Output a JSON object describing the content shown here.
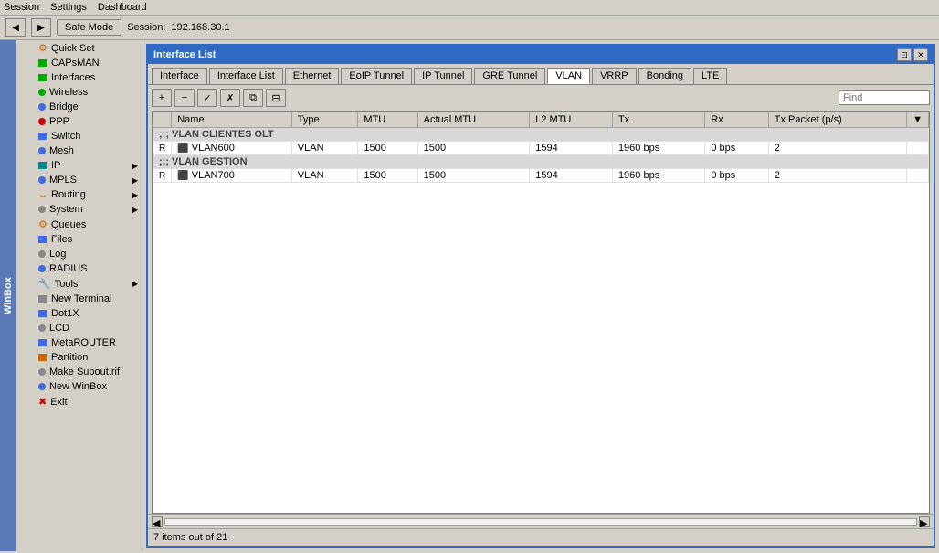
{
  "menubar": {
    "items": [
      "Session",
      "Settings",
      "Dashboard"
    ]
  },
  "toolbar": {
    "back_label": "◀",
    "forward_label": "▶",
    "safe_mode_label": "Safe Mode",
    "session_prefix": "Session:",
    "session_ip": "192.168.30.1"
  },
  "sidebar": {
    "items": [
      {
        "label": "Quick Set",
        "icon": "wrench",
        "color": "orange"
      },
      {
        "label": "CAPsMAN",
        "icon": "antenna",
        "color": "green"
      },
      {
        "label": "Interfaces",
        "icon": "interfaces",
        "color": "green"
      },
      {
        "label": "Wireless",
        "icon": "wireless",
        "color": "green"
      },
      {
        "label": "Bridge",
        "icon": "bridge",
        "color": "blue"
      },
      {
        "label": "PPP",
        "icon": "ppp",
        "color": "red"
      },
      {
        "label": "Switch",
        "icon": "switch",
        "color": "blue"
      },
      {
        "label": "Mesh",
        "icon": "mesh",
        "color": "blue"
      },
      {
        "label": "IP",
        "icon": "ip",
        "color": "blue",
        "has_sub": true
      },
      {
        "label": "MPLS",
        "icon": "mpls",
        "color": "blue",
        "has_sub": true
      },
      {
        "label": "Routing",
        "icon": "routing",
        "color": "orange",
        "has_sub": true
      },
      {
        "label": "System",
        "icon": "system",
        "color": "gray",
        "has_sub": true
      },
      {
        "label": "Queues",
        "icon": "queues",
        "color": "orange"
      },
      {
        "label": "Files",
        "icon": "files",
        "color": "blue"
      },
      {
        "label": "Log",
        "icon": "log",
        "color": "gray"
      },
      {
        "label": "RADIUS",
        "icon": "radius",
        "color": "blue"
      },
      {
        "label": "Tools",
        "icon": "tools",
        "color": "red",
        "has_sub": true
      },
      {
        "label": "New Terminal",
        "icon": "terminal",
        "color": "gray"
      },
      {
        "label": "Dot1X",
        "icon": "dot1x",
        "color": "blue"
      },
      {
        "label": "LCD",
        "icon": "lcd",
        "color": "gray"
      },
      {
        "label": "MetaROUTER",
        "icon": "metarouter",
        "color": "blue"
      },
      {
        "label": "Partition",
        "icon": "partition",
        "color": "orange"
      },
      {
        "label": "Make Supout.rif",
        "icon": "supout",
        "color": "gray"
      },
      {
        "label": "New WinBox",
        "icon": "winbox",
        "color": "blue"
      },
      {
        "label": "Exit",
        "icon": "exit",
        "color": "red"
      }
    ],
    "winbox_label": "WinBox"
  },
  "window": {
    "title": "Interface List",
    "tabs": [
      {
        "label": "Interface",
        "active": false
      },
      {
        "label": "Interface List",
        "active": false
      },
      {
        "label": "Ethernet",
        "active": false
      },
      {
        "label": "EoIP Tunnel",
        "active": false
      },
      {
        "label": "IP Tunnel",
        "active": false
      },
      {
        "label": "GRE Tunnel",
        "active": false
      },
      {
        "label": "VLAN",
        "active": true
      },
      {
        "label": "VRRP",
        "active": false
      },
      {
        "label": "Bonding",
        "active": false
      },
      {
        "label": "LTE",
        "active": false
      }
    ],
    "toolbar_buttons": [
      {
        "label": "+",
        "title": "Add"
      },
      {
        "label": "−",
        "title": "Remove"
      },
      {
        "label": "✓",
        "title": "Enable"
      },
      {
        "label": "✗",
        "title": "Disable"
      },
      {
        "label": "⧉",
        "title": "Copy"
      },
      {
        "label": "⊟",
        "title": "Filter"
      }
    ],
    "search_placeholder": "Find",
    "table": {
      "columns": [
        "",
        "Name",
        "Type",
        "MTU",
        "Actual MTU",
        "L2 MTU",
        "Tx",
        "Rx",
        "Tx Packet (p/s)",
        ""
      ],
      "sections": [
        {
          "header": ";;; VLAN CLIENTES OLT",
          "rows": [
            {
              "flag": "R",
              "name": "VLAN600",
              "type": "VLAN",
              "mtu": "1500",
              "actual_mtu": "1500",
              "l2_mtu": "1594",
              "tx": "1960 bps",
              "rx": "0 bps",
              "tx_pps": "2"
            }
          ]
        },
        {
          "header": ";;; VLAN GESTION",
          "rows": [
            {
              "flag": "R",
              "name": "VLAN700",
              "type": "VLAN",
              "mtu": "1500",
              "actual_mtu": "1500",
              "l2_mtu": "1594",
              "tx": "1960 bps",
              "rx": "0 bps",
              "tx_pps": "2"
            }
          ]
        }
      ]
    },
    "status": "7 items out of 21"
  }
}
